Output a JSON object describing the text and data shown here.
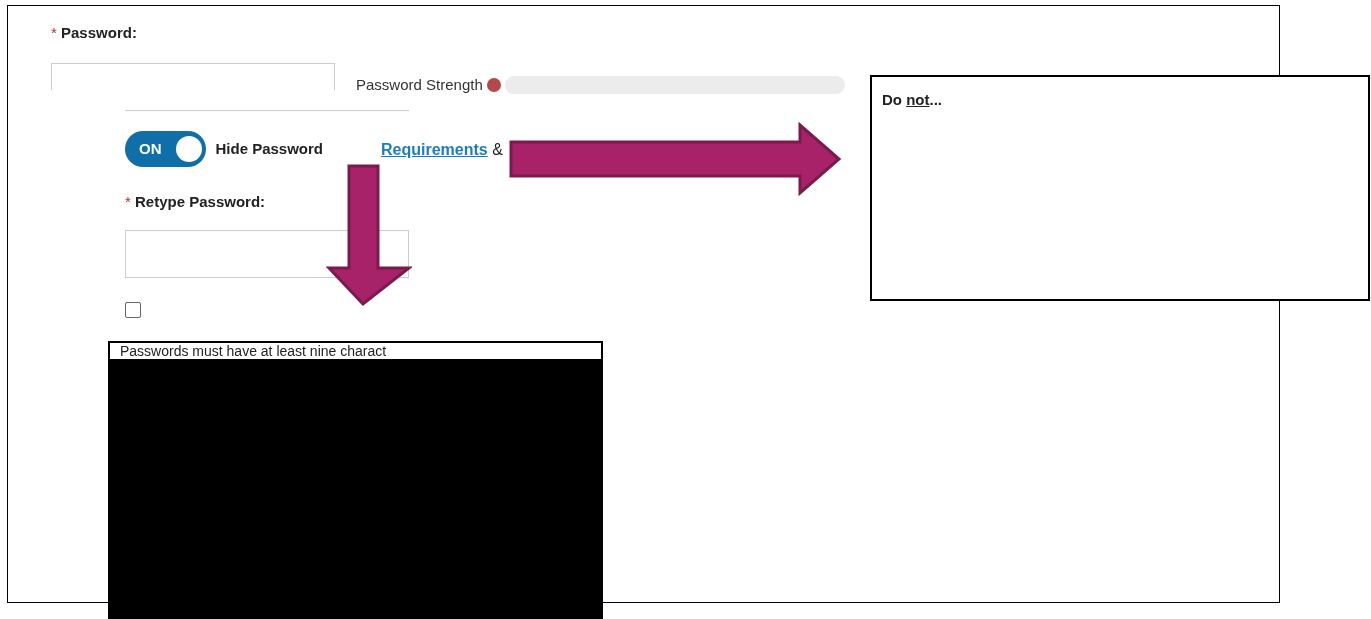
{
  "password_field": {
    "label": "Password:",
    "required_mark": "*"
  },
  "strength": {
    "label": "Password Strength"
  },
  "toggle": {
    "label": "ON",
    "on": true,
    "caption": "Hide Password"
  },
  "links": {
    "requirements": "Requirements",
    "separator": "&"
  },
  "retype_field": {
    "label": "Retype Password:",
    "required_mark": "*"
  },
  "checkbox": {
    "checked": false
  },
  "callout": {
    "title_start": "Do ",
    "title_emphasis": "not",
    "title_end": "..."
  },
  "rules_panel": {
    "text": "Passwords must have at least nine charact"
  }
}
